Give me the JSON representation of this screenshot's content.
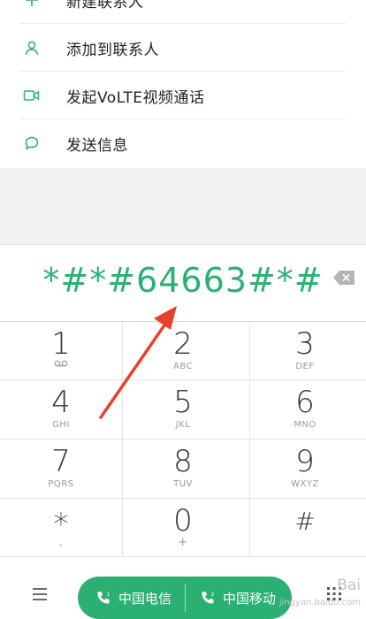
{
  "actions": [
    {
      "label": "新建联系人",
      "icon": "plus-icon"
    },
    {
      "label": "添加到联系人",
      "icon": "person-icon"
    },
    {
      "label": "发起VoLTE视频通话",
      "icon": "video-icon"
    },
    {
      "label": "发送信息",
      "icon": "message-icon"
    }
  ],
  "dialer": {
    "number": "*#*#64663#*#"
  },
  "keys": [
    {
      "digit": "1",
      "sub": "⌴⌴"
    },
    {
      "digit": "2",
      "sub": "ABC"
    },
    {
      "digit": "3",
      "sub": "DEF"
    },
    {
      "digit": "4",
      "sub": "GHI"
    },
    {
      "digit": "5",
      "sub": "JKL"
    },
    {
      "digit": "6",
      "sub": "MNO"
    },
    {
      "digit": "7",
      "sub": "PQRS"
    },
    {
      "digit": "8",
      "sub": "TUV"
    },
    {
      "digit": "9",
      "sub": "WXYZ"
    },
    {
      "digit": "*",
      "sub": ","
    },
    {
      "digit": "0",
      "sub": "+"
    },
    {
      "digit": "#",
      "sub": ""
    }
  ],
  "bottom": {
    "call1": "中国电信",
    "call2": "中国移动"
  },
  "watermark": {
    "main": "Bai",
    "sub": "jingyan.baidu.com"
  },
  "colors": {
    "accent": "#2bb073",
    "arrow": "#e8402f"
  }
}
